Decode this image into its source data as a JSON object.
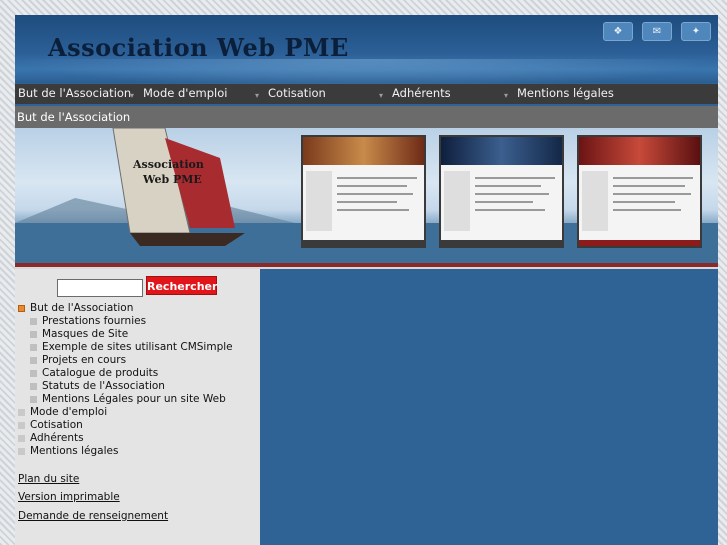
{
  "header": {
    "title": "Association Web PME",
    "icons": [
      "home-icon",
      "mail-icon",
      "sitemap-icon"
    ]
  },
  "menu": {
    "items": [
      {
        "label": "But de l'Association"
      },
      {
        "label": "Mode d'emploi"
      },
      {
        "label": "Cotisation"
      },
      {
        "label": "Adhérents"
      },
      {
        "label": "Mentions légales"
      }
    ]
  },
  "breadcrumb": "But de l'Association",
  "banner": {
    "boat_text_1": "Association",
    "boat_text_2": "Web PME"
  },
  "search": {
    "value": "",
    "button_label": "Rechercher"
  },
  "sidebar": {
    "current": "But de l'Association",
    "subitems": [
      "Prestations fournies",
      "Masques de Site",
      "Exemple de sites utilisant CMSimple",
      "Projets en cours",
      "Catalogue de produits",
      "Statuts de l'Association",
      "Mentions Légales pour un site Web"
    ],
    "others": [
      "Mode d'emploi",
      "Cotisation",
      "Adhérents",
      "Mentions légales"
    ],
    "links": [
      "Plan du site",
      "Version imprimable",
      "Demande de renseignement"
    ]
  },
  "colors": {
    "header_blue": "#2b5f96",
    "menu_bg": "#3b3b3b",
    "search_button": "#e0161b",
    "content_blue": "#2f6396",
    "sidebar_bg": "#e4e4e4"
  }
}
